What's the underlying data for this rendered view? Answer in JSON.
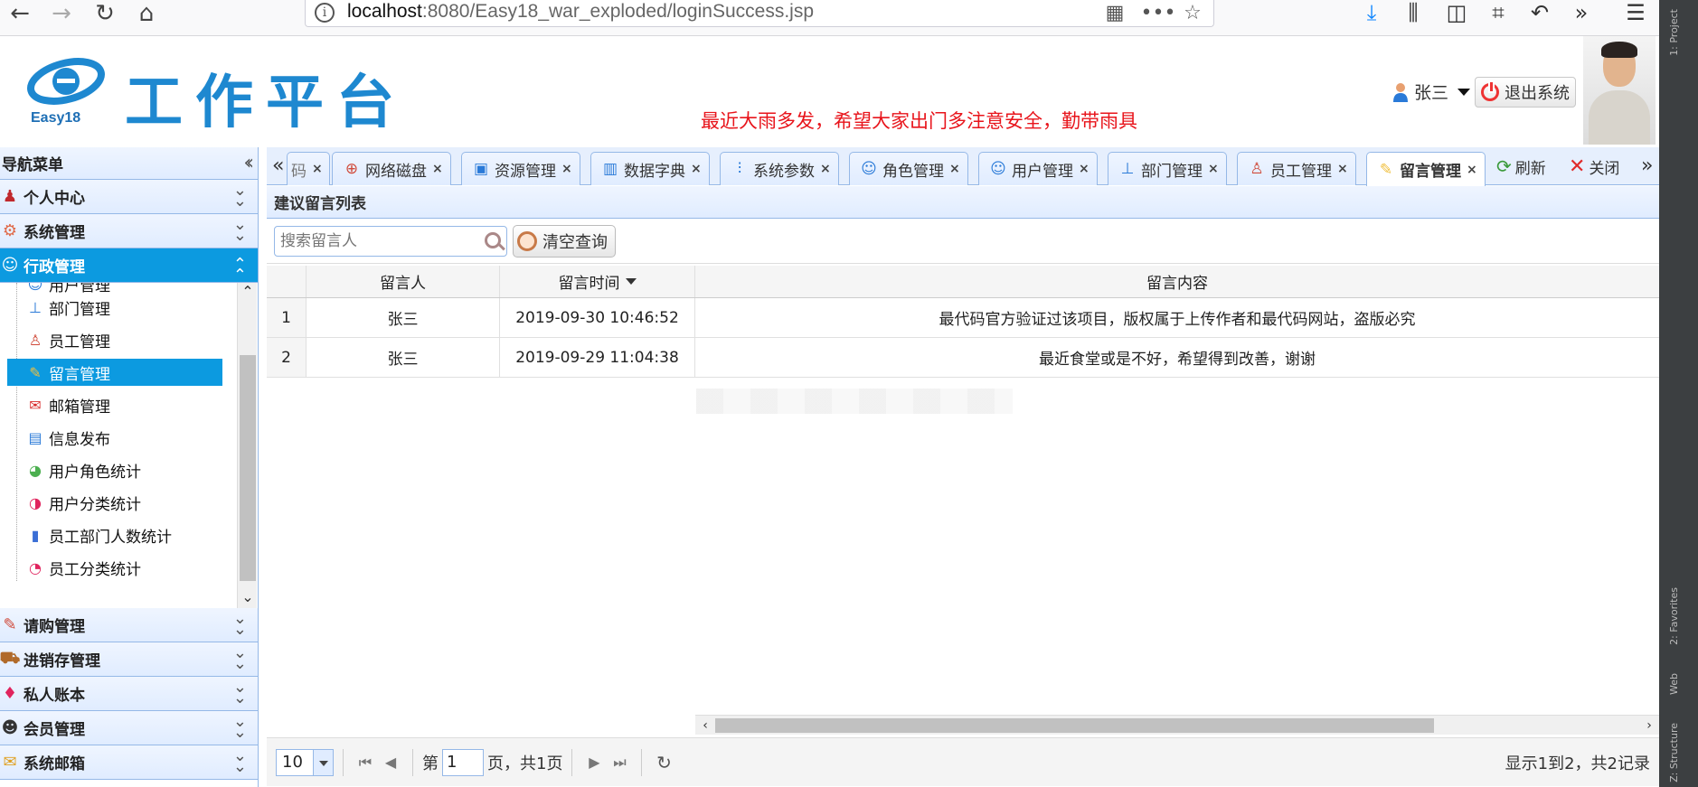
{
  "browser": {
    "url_host": "localhost",
    "url_rest": ":8080/Easy18_war_exploded/loginSuccess.jsp"
  },
  "header": {
    "logo_sub": "Easy18",
    "logo_title": "工作平台",
    "marquee": "最近大雨多发，希望大家出门多注意安全，勤带雨具",
    "user_name": "张三",
    "logout_label": "退出系统"
  },
  "sidebar": {
    "title": "导航菜单",
    "sections_top": [
      {
        "label": "个人中心"
      },
      {
        "label": "系统管理"
      },
      {
        "label": "行政管理"
      }
    ],
    "tree_items": [
      {
        "label": "用户管理"
      },
      {
        "label": "部门管理"
      },
      {
        "label": "员工管理"
      },
      {
        "label": "留言管理"
      },
      {
        "label": "邮箱管理"
      },
      {
        "label": "信息发布"
      },
      {
        "label": "用户角色统计"
      },
      {
        "label": "用户分类统计"
      },
      {
        "label": "员工部门人数统计"
      },
      {
        "label": "员工分类统计"
      }
    ],
    "sections_bottom": [
      {
        "label": "请购管理"
      },
      {
        "label": "进销存管理"
      },
      {
        "label": "私人账本"
      },
      {
        "label": "会员管理"
      },
      {
        "label": "系统邮箱"
      }
    ]
  },
  "tabs": {
    "items": [
      {
        "label": "码"
      },
      {
        "label": "网络磁盘"
      },
      {
        "label": "资源管理"
      },
      {
        "label": "数据字典"
      },
      {
        "label": "系统参数"
      },
      {
        "label": "角色管理"
      },
      {
        "label": "用户管理"
      },
      {
        "label": "部门管理"
      },
      {
        "label": "员工管理"
      },
      {
        "label": "留言管理"
      }
    ],
    "refresh_label": "刷新",
    "close_label": "关闭"
  },
  "panel": {
    "title": "建议留言列表",
    "search_placeholder": "搜索留言人",
    "clear_label": "清空查询",
    "columns": [
      "留言人",
      "留言时间",
      "留言内容"
    ],
    "rows": [
      {
        "num": "1",
        "person": "张三",
        "time": "2019-09-30 10:46:52",
        "content": "最代码官方验证过该项目，版权属于上传作者和最代码网站，盗版必究"
      },
      {
        "num": "2",
        "person": "张三",
        "time": "2019-09-29 11:04:38",
        "content": "最近食堂或是不好，希望得到改善，谢谢"
      }
    ]
  },
  "pager": {
    "page_size": "10",
    "page_prefix": "第",
    "page_num": "1",
    "page_suffix": "页，共1页",
    "info": "显示1到2，共2记录"
  },
  "ide": {
    "labels": [
      "1: Project",
      "2: Favorites",
      "Web",
      "Z: Structure"
    ]
  }
}
